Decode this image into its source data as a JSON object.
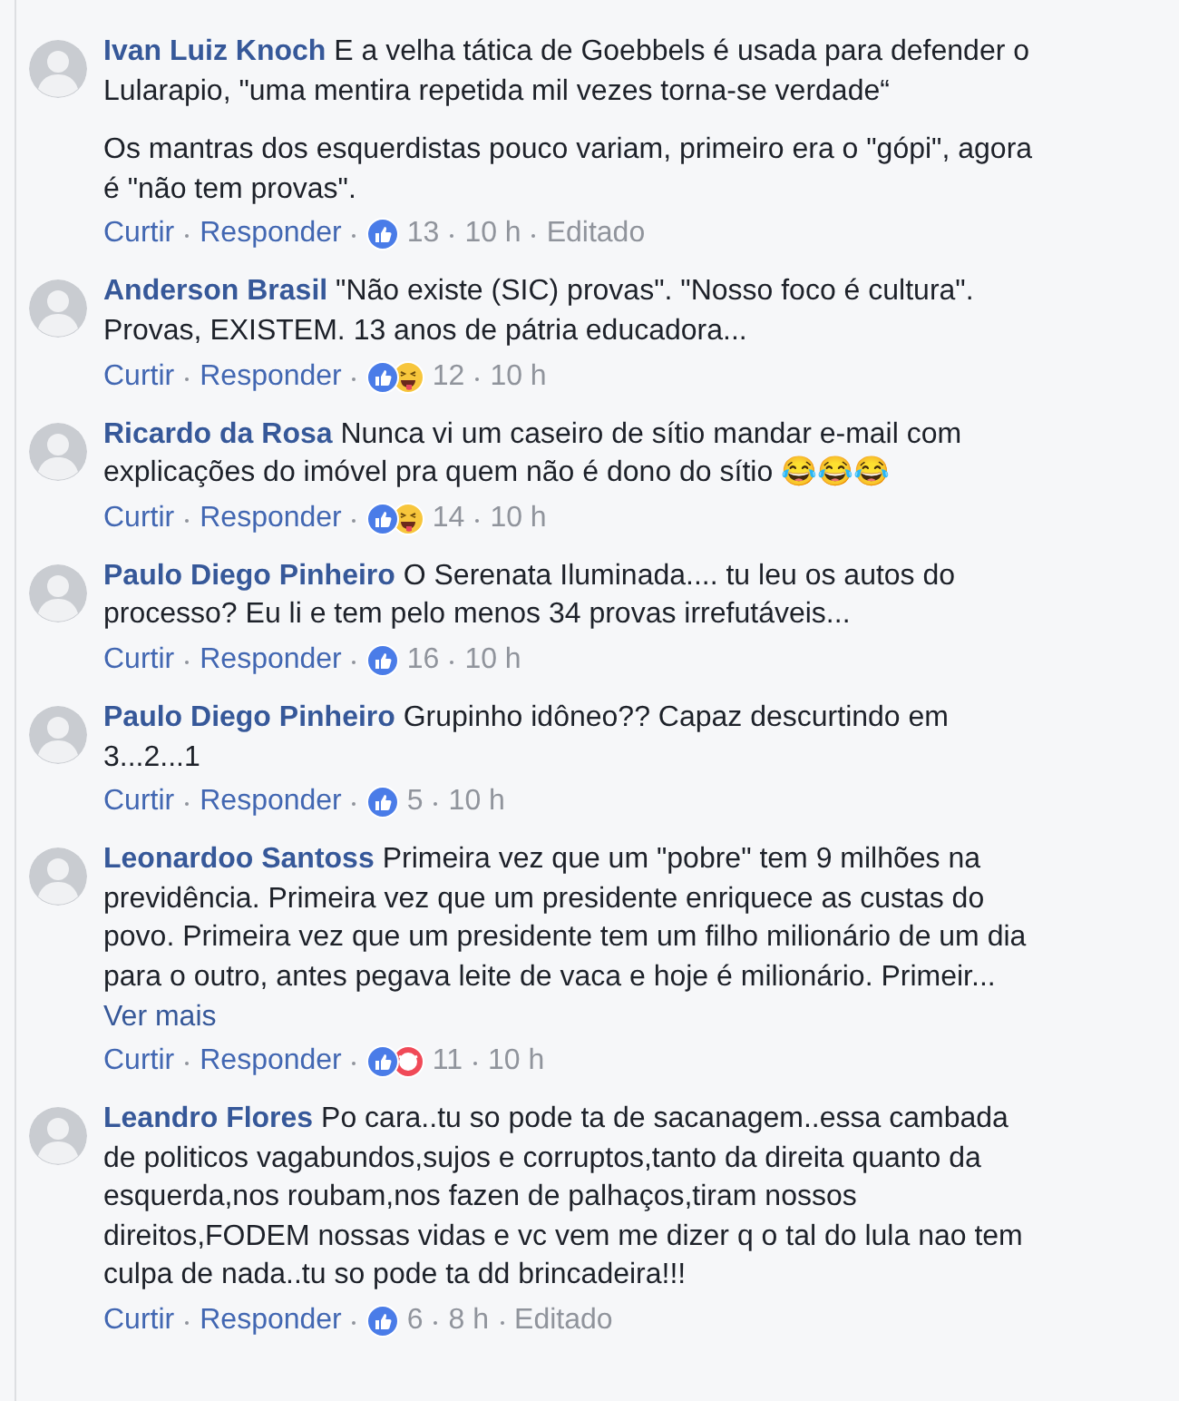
{
  "comments": [
    {
      "author": "Ivan Luiz Knoch",
      "paragraphs": [
        "E a velha tática de Goebbels é usada para defender o Lularapio, \"uma mentira repetida mil vezes torna-se verdade“",
        "Os mantras dos esquerdistas pouco variam, primeiro era o \"gópi\", agora é \"não tem provas\"."
      ],
      "actions": [
        "Curtir",
        "Responder"
      ],
      "reactions": [
        {
          "kind": "like"
        }
      ],
      "count": "13",
      "time": "10 h",
      "edited": "Editado"
    },
    {
      "author": "Anderson Brasil",
      "paragraphs": [
        "\"Não existe (SIC) provas\". \"Nosso foco é cultura\". Provas, EXISTEM. 13 anos de pátria educadora..."
      ],
      "actions": [
        "Curtir",
        "Responder"
      ],
      "reactions": [
        {
          "kind": "like"
        },
        {
          "kind": "haha"
        }
      ],
      "count": "12",
      "time": "10 h"
    },
    {
      "author": "Ricardo da Rosa",
      "paragraphs": [
        "Nunca vi um caseiro de sítio mandar e-mail com explicações do imóvel pra quem não é dono do sítio 😂😂😂"
      ],
      "actions": [
        "Curtir",
        "Responder"
      ],
      "reactions": [
        {
          "kind": "like"
        },
        {
          "kind": "haha"
        }
      ],
      "count": "14",
      "time": "10 h"
    },
    {
      "author": "Paulo Diego Pinheiro",
      "paragraphs": [
        "O Serenata Iluminada.... tu leu os autos do processo? Eu li e tem pelo menos 34 provas irrefutáveis..."
      ],
      "actions": [
        "Curtir",
        "Responder"
      ],
      "reactions": [
        {
          "kind": "like"
        }
      ],
      "count": "16",
      "time": "10 h"
    },
    {
      "author": "Paulo Diego Pinheiro",
      "paragraphs": [
        "Grupinho idôneo?? Capaz descurtindo em 3...2...1"
      ],
      "actions": [
        "Curtir",
        "Responder"
      ],
      "reactions": [
        {
          "kind": "like"
        }
      ],
      "count": "5",
      "time": "10 h"
    },
    {
      "author": "Leonardoo Santoss",
      "paragraphs": [
        "Primeira vez que um \"pobre\" tem 9 milhões na previdência. Primeira vez que um presidente enriquece as custas do povo. Primeira vez que um presidente tem um filho milionário de um dia para o outro, antes pegava leite de vaca e hoje é milionário. Primeir..."
      ],
      "see_more": "Ver mais",
      "actions": [
        "Curtir",
        "Responder"
      ],
      "reactions": [
        {
          "kind": "like"
        },
        {
          "kind": "angry"
        }
      ],
      "count": "11",
      "time": "10 h"
    },
    {
      "author": "Leandro Flores",
      "paragraphs": [
        "Po cara..tu so pode ta de sacanagem..essa cambada de politicos vagabundos,sujos e corruptos,tanto da direita quanto da esquerda,nos roubam,nos fazen de palhaços,tiram nossos direitos,FODEM nossas vidas e vc vem me dizer q o tal do lula nao tem culpa de nada..tu so pode ta dd brincadeira!!!"
      ],
      "actions": [
        "Curtir",
        "Responder"
      ],
      "reactions": [
        {
          "kind": "like"
        }
      ],
      "count": "6",
      "time": "8 h",
      "edited": "Editado"
    }
  ]
}
